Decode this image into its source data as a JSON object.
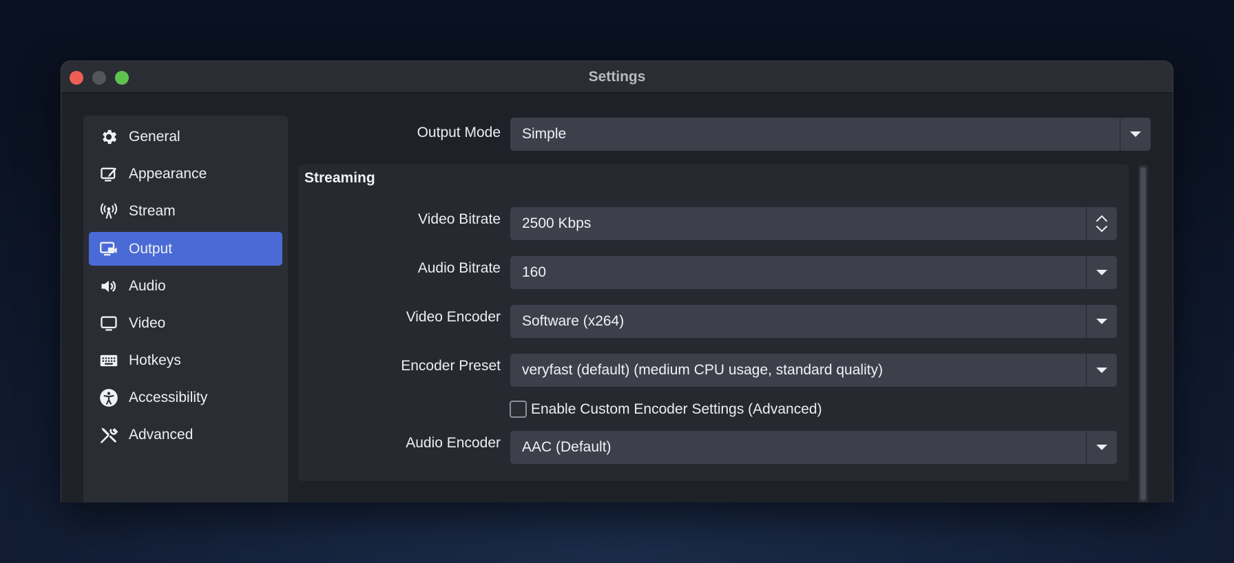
{
  "window": {
    "title": "Settings"
  },
  "sidebar": {
    "items": [
      {
        "label": "General",
        "icon": "gear-icon"
      },
      {
        "label": "Appearance",
        "icon": "appearance-icon"
      },
      {
        "label": "Stream",
        "icon": "antenna-icon"
      },
      {
        "label": "Output",
        "icon": "output-icon",
        "active": true
      },
      {
        "label": "Audio",
        "icon": "speaker-icon"
      },
      {
        "label": "Video",
        "icon": "monitor-icon"
      },
      {
        "label": "Hotkeys",
        "icon": "keyboard-icon"
      },
      {
        "label": "Accessibility",
        "icon": "accessibility-icon"
      },
      {
        "label": "Advanced",
        "icon": "wrench-icon"
      }
    ]
  },
  "output": {
    "mode_label": "Output Mode",
    "mode_value": "Simple"
  },
  "streaming": {
    "title": "Streaming",
    "video_bitrate_label": "Video Bitrate",
    "video_bitrate_value": "2500 Kbps",
    "audio_bitrate_label": "Audio Bitrate",
    "audio_bitrate_value": "160",
    "video_encoder_label": "Video Encoder",
    "video_encoder_value": "Software (x264)",
    "encoder_preset_label": "Encoder Preset",
    "encoder_preset_value": "veryfast (default) (medium CPU usage, standard quality)",
    "custom_encoder_label": "Enable Custom Encoder Settings (Advanced)",
    "custom_encoder_checked": false,
    "audio_encoder_label": "Audio Encoder",
    "audio_encoder_value": "AAC (Default)"
  },
  "colors": {
    "accent": "#4a6ad6",
    "window_bg": "#1f2128",
    "sidebar_bg": "#2b2d35",
    "field_bg": "#3d3f4a"
  }
}
